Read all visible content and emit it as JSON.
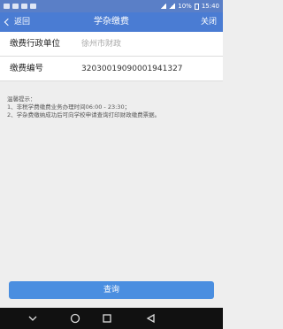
{
  "status_bar": {
    "signal": "10%",
    "time": "15:40"
  },
  "header": {
    "back_label": "返回",
    "title": "学杂缴费",
    "close_label": "关闭"
  },
  "form": {
    "fields": [
      {
        "label": "缴费行政单位",
        "value": "徐州市财政",
        "placeholder": true
      },
      {
        "label": "缴费编号",
        "value": "32030019090001941327",
        "placeholder": false
      }
    ]
  },
  "tips": {
    "title": "温馨提示：",
    "lines": [
      "1、非税学费缴费业务办理时间06:00 - 23:30；",
      "2、学杂费缴纳成功后可向学校申请查询打印财政缴费票据。"
    ]
  },
  "query_button": "查询",
  "colors": {
    "header": "#4a7cd3",
    "button": "#4a8ee0"
  }
}
